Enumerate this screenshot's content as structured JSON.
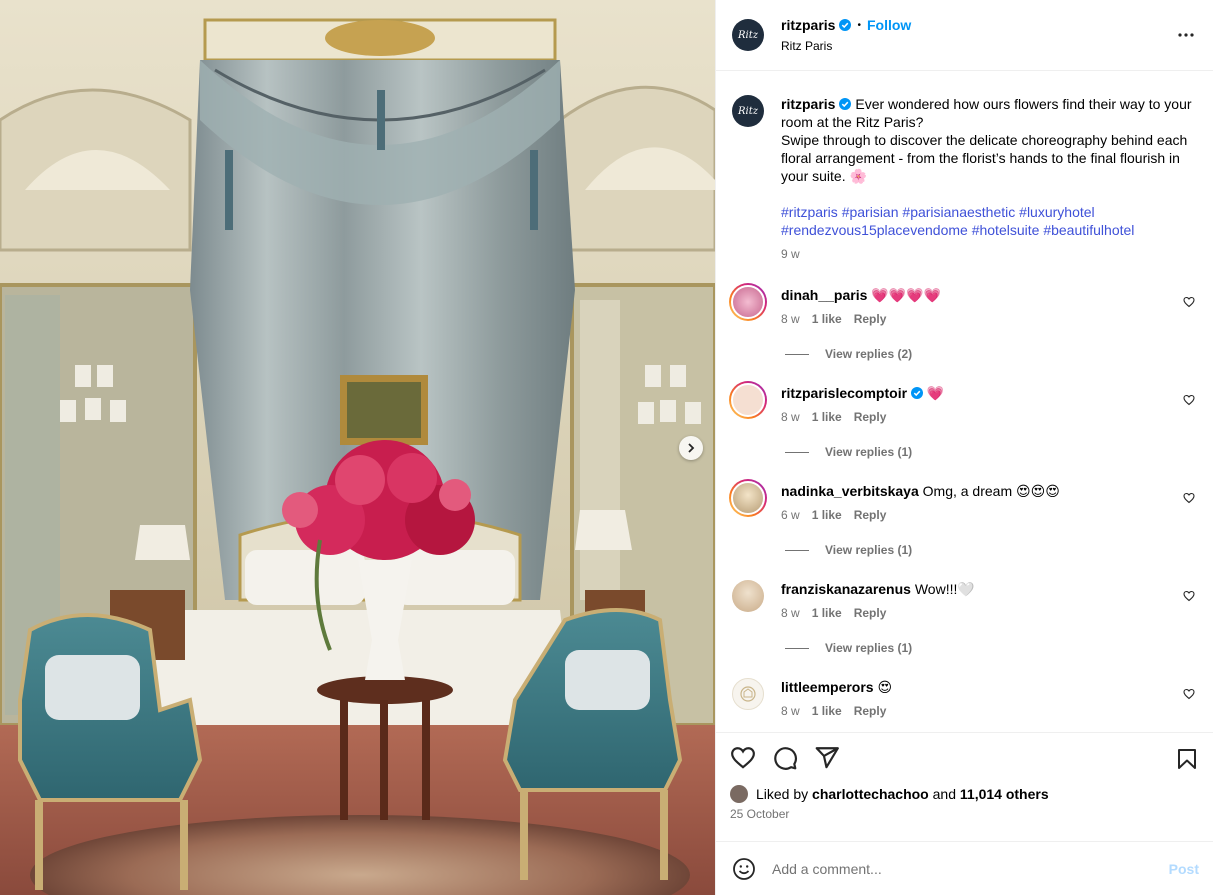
{
  "post": {
    "username": "ritzparis",
    "follow_label": "Follow",
    "location": "Ritz Paris",
    "avatar_text": "Ritz",
    "caption_line1": "Ever wondered how ours flowers find their way to your room at the Ritz Paris?",
    "caption_line2": "Swipe through to discover the delicate choreography behind each floral arrangement - from the florist’s hands to the final flourish in your suite. 🌸",
    "hashtags": [
      "#ritzparis",
      "#parisian",
      "#parisianaesthetic",
      "#luxuryhotel",
      "#rendezvous15placevendome",
      "#hotelsuite",
      "#beautifulhotel"
    ],
    "time_ago": "9 w"
  },
  "comments": [
    {
      "username": "dinah__paris",
      "text": "💗💗💗💗",
      "time": "8 w",
      "likes": "1 like",
      "reply_label": "Reply",
      "view_replies": "View replies (2)",
      "verified": false
    },
    {
      "username": "ritzparislecomptoir",
      "text": "💗",
      "time": "8 w",
      "likes": "1 like",
      "reply_label": "Reply",
      "view_replies": "View replies (1)",
      "verified": true
    },
    {
      "username": "nadinka_verbitskaya",
      "text": "Omg, a dream 😍😍😍",
      "time": "6 w",
      "likes": "1 like",
      "reply_label": "Reply",
      "view_replies": "View replies (1)",
      "verified": false
    },
    {
      "username": "franziskanazarenus",
      "text": "Wow!!!🤍",
      "time": "8 w",
      "likes": "1 like",
      "reply_label": "Reply",
      "view_replies": "View replies (1)",
      "verified": false
    },
    {
      "username": "littleemperors",
      "text": "😍",
      "time": "8 w",
      "likes": "1 like",
      "reply_label": "Reply",
      "verified": false
    }
  ],
  "likes": {
    "prefix": "Liked by",
    "user": "charlottechachoo",
    "and": "and",
    "count": "11,014 others"
  },
  "date": "25 October",
  "add_comment": {
    "placeholder": "Add a comment...",
    "post_label": "Post"
  },
  "colors": {
    "link": "#0095f6",
    "hashtag": "#3f51d8",
    "muted": "#737373",
    "post_disabled": "#b3dbff"
  }
}
